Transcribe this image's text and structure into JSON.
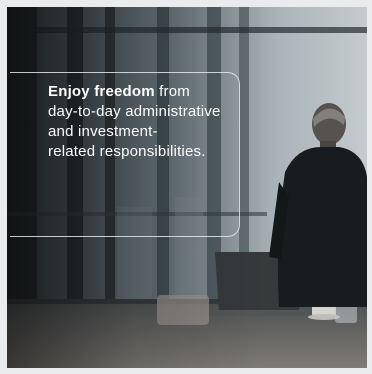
{
  "promo": {
    "headline_bold": "Enjoy freedom",
    "headline_rest": " from",
    "headline_line2": "day-to-day administrative",
    "headline_line3": "and investment-",
    "headline_line4": "related responsibilities."
  },
  "image": {
    "subject": "businessman-looking-out-window"
  },
  "colors": {
    "frame": "#e9ebec",
    "text": "#ffffff",
    "callout_border": "#e6e9ec"
  }
}
